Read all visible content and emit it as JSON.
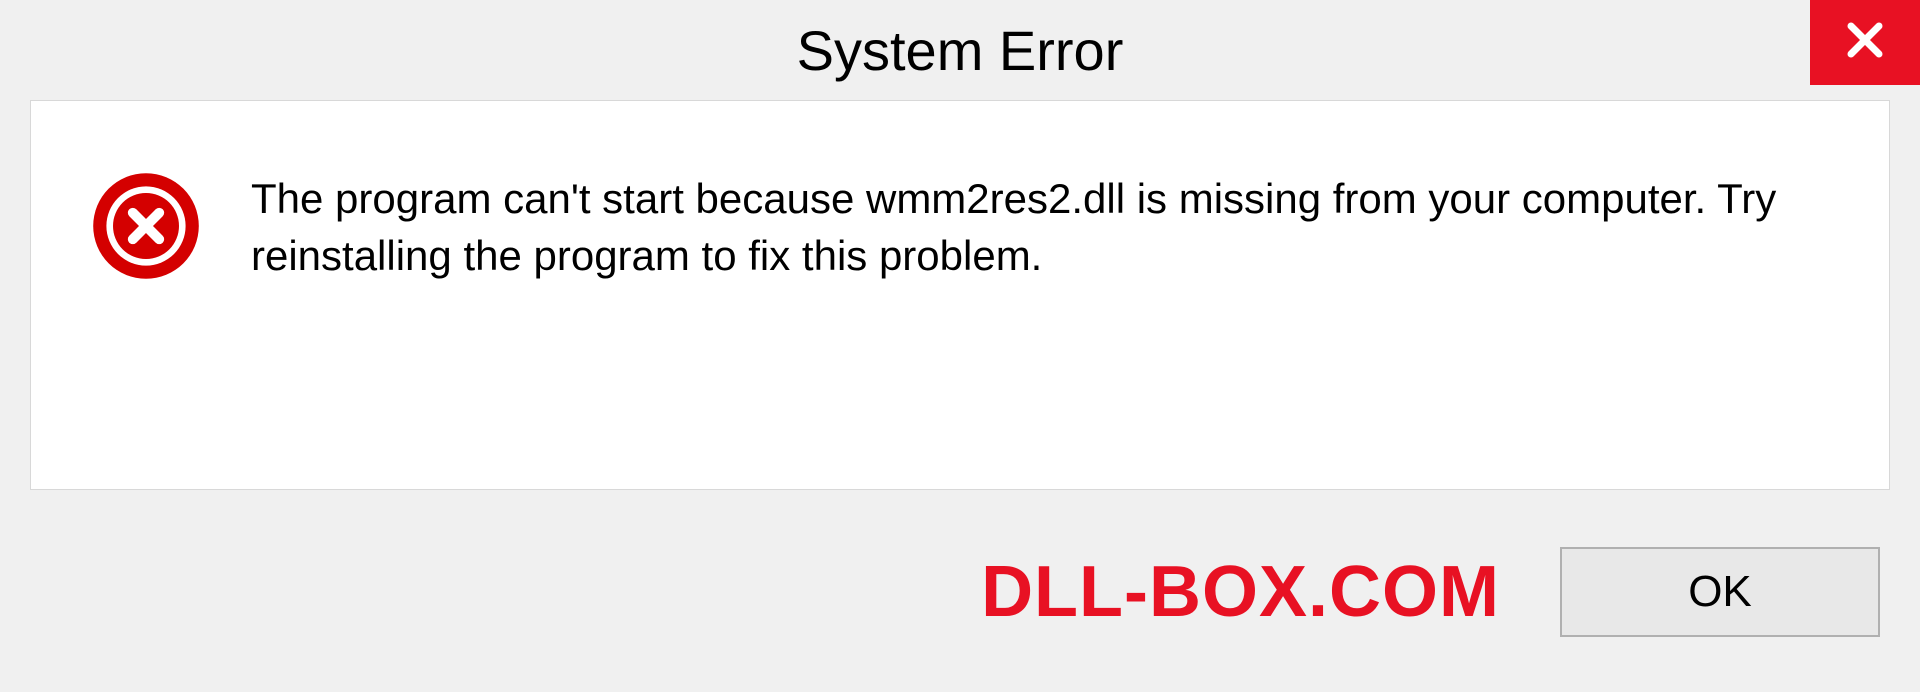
{
  "titlebar": {
    "title": "System Error",
    "close_icon": "close-icon"
  },
  "dialog": {
    "error_icon": "error-circle-x-icon",
    "message": "The program can't start because wmm2res2.dll is missing from your computer. Try reinstalling the program to fix this problem."
  },
  "footer": {
    "watermark": "DLL-BOX.COM",
    "ok_label": "OK"
  },
  "colors": {
    "close_red": "#e81123",
    "error_red": "#d40000",
    "panel_bg": "#ffffff",
    "window_bg": "#f0f0f0"
  }
}
